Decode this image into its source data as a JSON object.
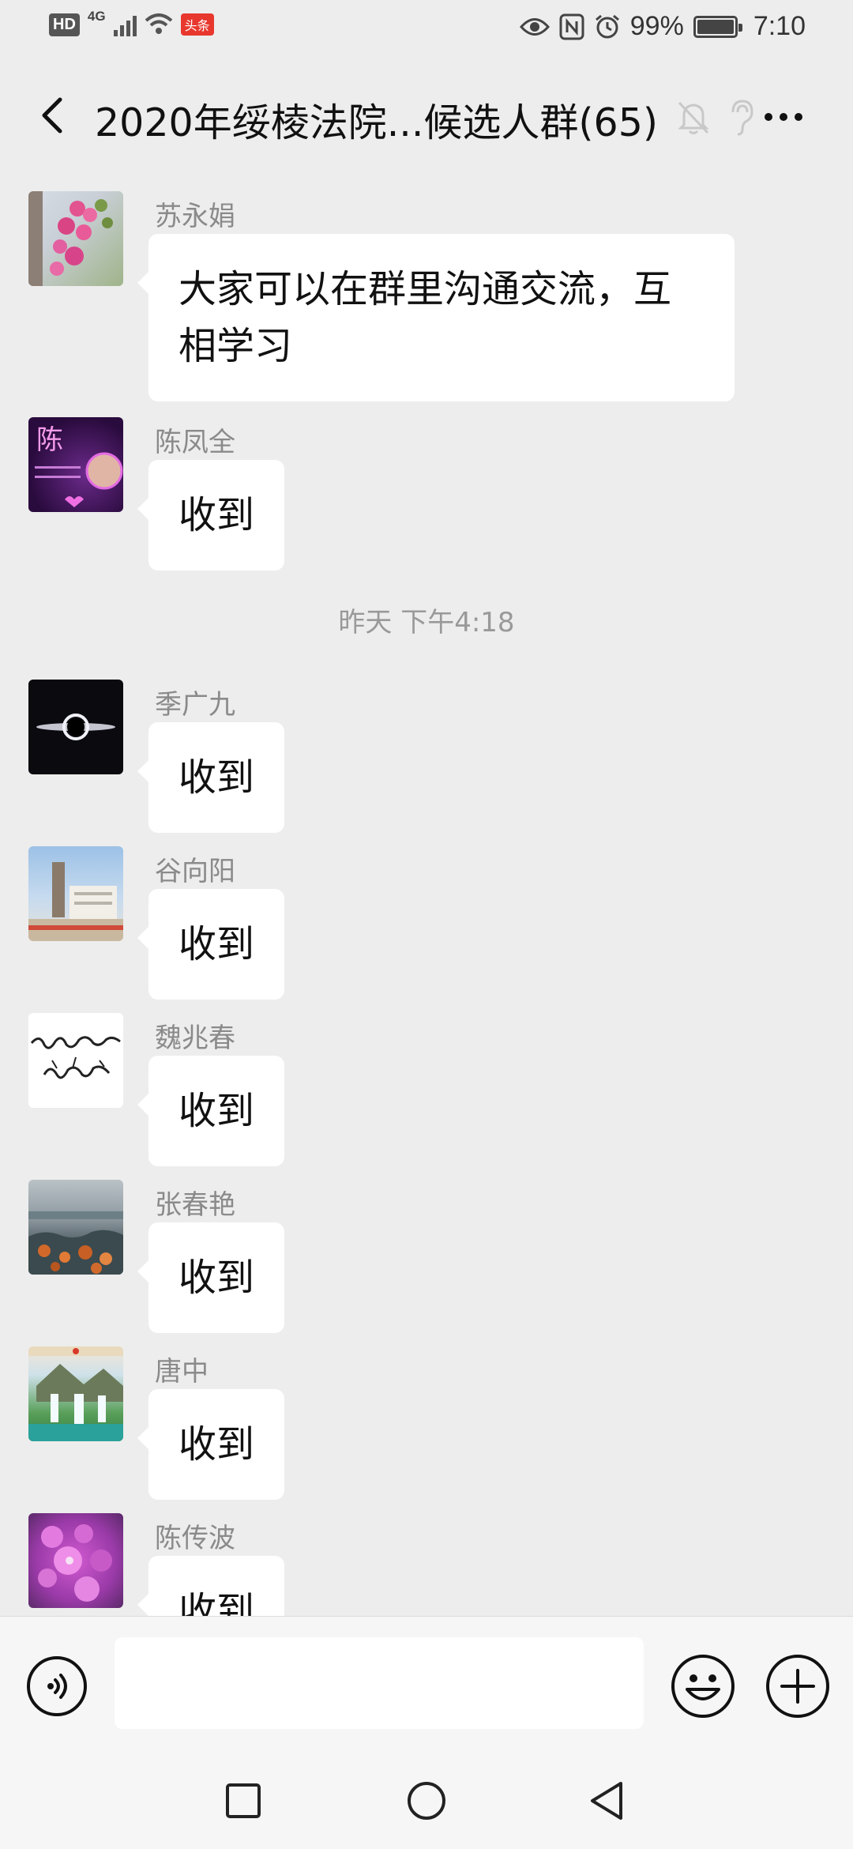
{
  "status_bar": {
    "hd": "HD",
    "network": "4G",
    "app_badge": "头条",
    "battery": "99%",
    "time": "7:10"
  },
  "header": {
    "title": "2020年绥棱法院...候选人群(65)"
  },
  "messages": [
    {
      "sender": "苏永娟",
      "text": "大家可以在群里沟通交流，互相学习"
    },
    {
      "sender": "陈凤全",
      "text": "收到"
    },
    {
      "sender": "季广九",
      "text": "收到"
    },
    {
      "sender": "谷向阳",
      "text": "收到"
    },
    {
      "sender": "魏兆春",
      "text": "收到"
    },
    {
      "sender": "张春艳",
      "text": "收到"
    },
    {
      "sender": "唐中",
      "text": "收到"
    },
    {
      "sender": "陈传波",
      "text": "收到"
    }
  ],
  "timestamp": "昨天 下午4:18",
  "avatars": {
    "chen_fengquan_char": "陈"
  },
  "input": {
    "value": ""
  },
  "colors": {
    "background": "#ededed",
    "bubble": "#ffffff",
    "sender_name": "#8a8a8a"
  }
}
